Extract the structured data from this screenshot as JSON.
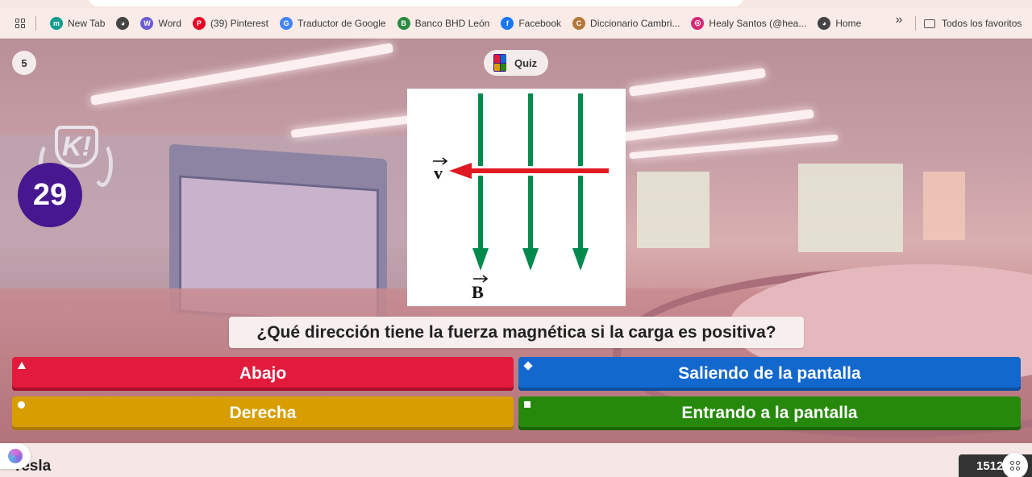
{
  "browser": {
    "bookmarks": [
      {
        "label": "New Tab",
        "icon": "new-tab-icon",
        "color": "#0f9d8f",
        "glyph": "m"
      },
      {
        "label": "",
        "icon": "globe-icon",
        "color": "#444444",
        "glyph": "◕"
      },
      {
        "label": "Word",
        "icon": "word-icon",
        "color": "#6b5bd6",
        "glyph": "W"
      },
      {
        "label": "(39) Pinterest",
        "icon": "pinterest-icon",
        "color": "#e60023",
        "glyph": "P"
      },
      {
        "label": "Traductor de Google",
        "icon": "google-translate-icon",
        "color": "#4285f4",
        "glyph": "G"
      },
      {
        "label": "Banco BHD León",
        "icon": "banco-bhd-icon",
        "color": "#2a8a3e",
        "glyph": "B"
      },
      {
        "label": "Facebook",
        "icon": "facebook-icon",
        "color": "#1877f2",
        "glyph": "f"
      },
      {
        "label": "Diccionario Cambri...",
        "icon": "cambridge-dictionary-icon",
        "color": "#b5793a",
        "glyph": "C"
      },
      {
        "label": "Healy Santos (@hea...",
        "icon": "instagram-icon",
        "color": "#d62976",
        "glyph": "◎"
      },
      {
        "label": "Home",
        "icon": "globe-icon",
        "color": "#444444",
        "glyph": "◕"
      }
    ],
    "more_label": "»",
    "all_bookmarks": "Todos los favoritos"
  },
  "game": {
    "question_number": "5",
    "quiz_label": "Quiz",
    "timer": "29",
    "logo_text": "K!",
    "question": "¿Qué dirección tiene la fuerza magnética si la carga es positiva?",
    "diagram": {
      "v_label": "v",
      "b_label": "B"
    },
    "answers": [
      {
        "label": "Abajo",
        "shape": "triangle",
        "color": "#e21b3c"
      },
      {
        "label": "Saliendo de la pantalla",
        "shape": "diamond",
        "color": "#1368ce"
      },
      {
        "label": "Derecha",
        "shape": "circle",
        "color": "#d89e00"
      },
      {
        "label": "Entrando a la pantalla",
        "shape": "square",
        "color": "#26890c"
      }
    ],
    "nickname": "Tesla",
    "score": "1512"
  }
}
